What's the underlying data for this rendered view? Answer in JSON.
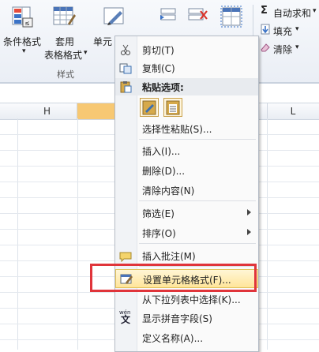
{
  "ribbon": {
    "conditional_format": "条件格式",
    "conditional_format_caret": "▾",
    "table_format_line1": "套用",
    "table_format_line2": "表格格式",
    "table_format_caret": "▾",
    "cell_style": "单元",
    "group_label": "样式",
    "autosum": "自动求和",
    "autosum_caret": "▾",
    "fill": "填充",
    "fill_caret": "▾",
    "clear": "清除",
    "clear_caret": "▾",
    "sigma": "Σ"
  },
  "sheet": {
    "columns": [
      "H",
      "",
      "L"
    ]
  },
  "menu": {
    "cut": "剪切(T)",
    "copy": "复制(C)",
    "paste_options": "粘贴选项:",
    "paste_special": "选择性粘贴(S)...",
    "insert": "插入(I)...",
    "delete": "删除(D)...",
    "clear_contents": "清除内容(N)",
    "filter": "筛选(E)",
    "sort": "排序(O)",
    "insert_comment": "插入批注(M)",
    "format_cells": "设置单元格格式(F)...",
    "pick_from_list": "从下拉列表中选择(K)...",
    "phonetic": "显示拼音字段(S)",
    "define_name": "定义名称(A)..."
  },
  "icons": {
    "phonetic_glyph_top": "wén",
    "phonetic_glyph": "文"
  },
  "colors": {
    "highlight": "#ffe59a",
    "annotation_red": "#e0343a",
    "selected_column": "#f7c873"
  }
}
